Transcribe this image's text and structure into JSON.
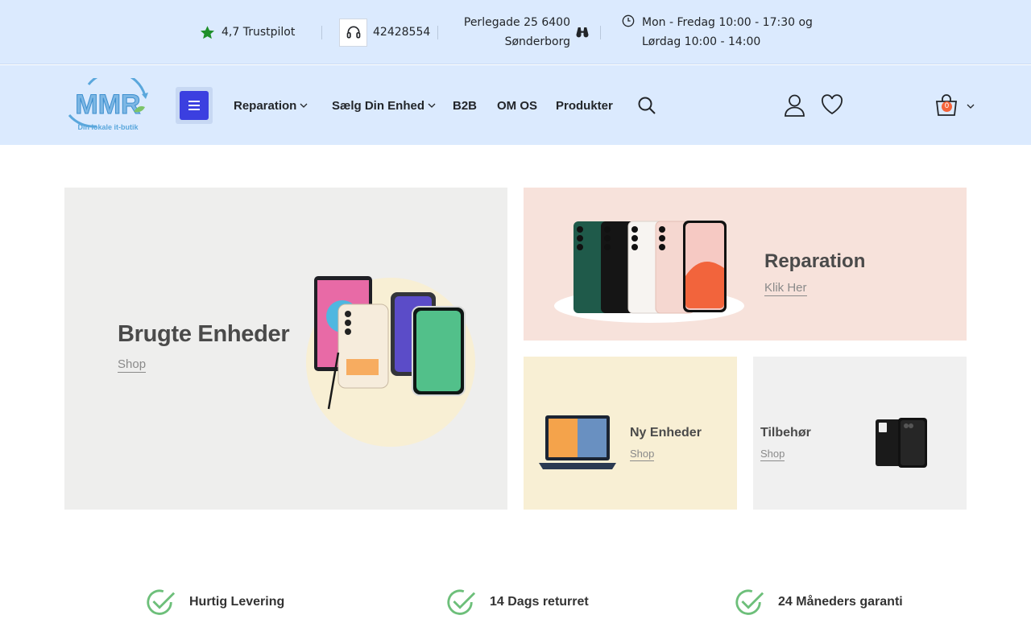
{
  "topbar": {
    "trustpilot": "4,7 Trustpilot",
    "phone": "42428554",
    "address_line1": "Perlegade 25 6400",
    "address_line2": "Sønderborg",
    "hours_line1": "Mon - Fredag 10:00 - 17:30 og",
    "hours_line2": "Lørdag 10:00 - 14:00",
    "icons": [
      "star-icon",
      "headset-icon",
      "binoculars-icon",
      "clock-icon"
    ]
  },
  "header": {
    "logo_text": "MMR",
    "logo_tagline": "Din lokale it-butik",
    "nav": [
      {
        "label": "Reparation",
        "dropdown": true
      },
      {
        "label": "Sælg Din Enhed",
        "dropdown": true
      },
      {
        "label": "B2B",
        "dropdown": false
      },
      {
        "label": "OM OS",
        "dropdown": false
      },
      {
        "label": "Produkter",
        "dropdown": false
      }
    ],
    "cart_count": "0",
    "icons": [
      "hamburger-menu-icon",
      "search-icon",
      "user-icon",
      "heart-icon",
      "shopping-bag-icon",
      "chevron-down-icon"
    ]
  },
  "banners": {
    "used": {
      "title": "Brugte Enheder",
      "link": "Shop"
    },
    "repair": {
      "title": "Reparation",
      "link": "Klik Her"
    },
    "new": {
      "title": "Ny Enheder",
      "link": "Shop"
    },
    "accessories": {
      "title": "Tilbehør",
      "link": "Shop"
    }
  },
  "features": [
    {
      "label": "Hurtig Levering"
    },
    {
      "label": "14 Dags returret"
    },
    {
      "label": "24 Måneders garanti"
    }
  ],
  "colors": {
    "header_bg": "#dbeafe",
    "menu_button": "#3b3fe0",
    "star": "#1e8f2a",
    "check": "#6dbf7a",
    "cart_badge": "#f4633a"
  }
}
